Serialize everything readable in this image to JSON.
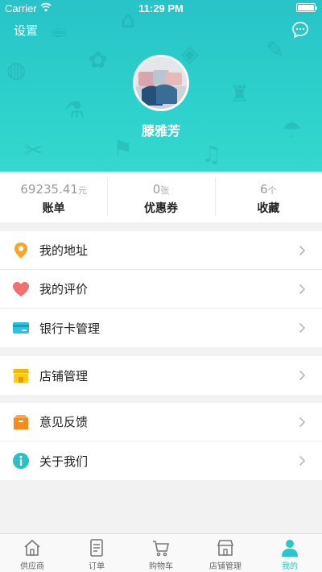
{
  "status_bar": {
    "carrier": "Carrier",
    "time": "11:29 PM"
  },
  "header": {
    "settings_label": "设置",
    "username": "滕雅芳",
    "accent_color": "#2cc6c6"
  },
  "stats": [
    {
      "value": "69235.41",
      "unit": "元",
      "label": "账单"
    },
    {
      "value": "0",
      "unit": "张",
      "label": "优惠券"
    },
    {
      "value": "6",
      "unit": "个",
      "label": "收藏"
    }
  ],
  "menu_groups": [
    [
      {
        "icon": "location-pin-icon",
        "label": "我的地址"
      },
      {
        "icon": "heart-icon",
        "label": "我的评价"
      },
      {
        "icon": "bank-card-icon",
        "label": "银行卡管理"
      }
    ],
    [
      {
        "icon": "store-icon",
        "label": "店铺管理"
      }
    ],
    [
      {
        "icon": "feedback-box-icon",
        "label": "意见反馈"
      },
      {
        "icon": "info-icon",
        "label": "关于我们"
      }
    ]
  ],
  "tabs": [
    {
      "icon": "home-icon",
      "label": "供应商",
      "active": false
    },
    {
      "icon": "document-icon",
      "label": "订单",
      "active": false
    },
    {
      "icon": "cart-icon",
      "label": "购物车",
      "active": false
    },
    {
      "icon": "storefront-icon",
      "label": "店铺管理",
      "active": false
    },
    {
      "icon": "person-icon",
      "label": "我的",
      "active": true
    }
  ]
}
